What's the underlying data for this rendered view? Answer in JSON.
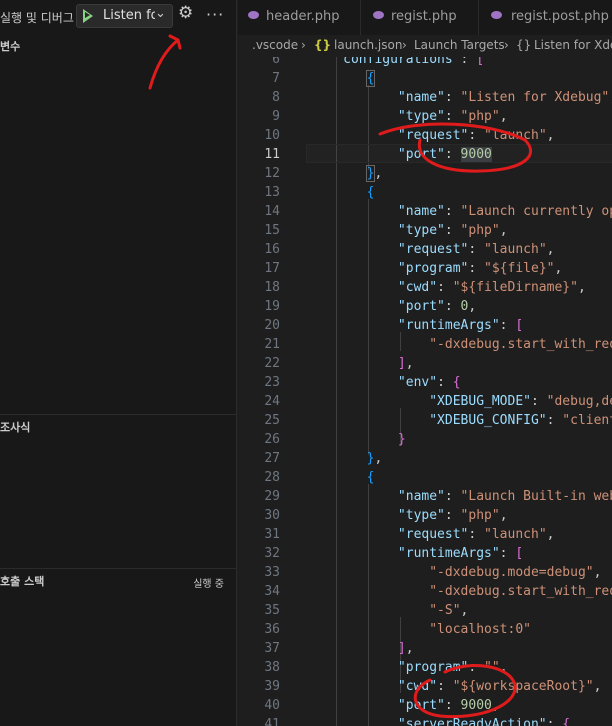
{
  "sidebar": {
    "title": "실행 및 디버그",
    "launch_config": "Listen for Xdebug",
    "sections": [
      {
        "label": "변수"
      },
      {
        "label": "조사식"
      },
      {
        "label": "호출 스택",
        "status": "실행 중"
      }
    ]
  },
  "tabs": [
    {
      "label": "header.php"
    },
    {
      "label": "regist.php"
    },
    {
      "label": "regist.post.php"
    }
  ],
  "breadcrumb": {
    "folder": ".vscode",
    "file_icon": "{}",
    "file": "launch.json",
    "node1": "Launch Targets",
    "node2_icon": "{}",
    "node2": "Listen for Xdebug"
  },
  "editor": {
    "current_line": 11,
    "lines": [
      {
        "n": "6"
      },
      {
        "n": "7"
      },
      {
        "n": "8"
      },
      {
        "n": "9"
      },
      {
        "n": "10"
      },
      {
        "n": "11"
      },
      {
        "n": "12"
      },
      {
        "n": "13"
      },
      {
        "n": "14"
      },
      {
        "n": "15"
      },
      {
        "n": "16"
      },
      {
        "n": "17"
      },
      {
        "n": "18"
      },
      {
        "n": "19"
      },
      {
        "n": "20"
      },
      {
        "n": "21"
      },
      {
        "n": "22"
      },
      {
        "n": "23"
      },
      {
        "n": "24"
      },
      {
        "n": "25"
      },
      {
        "n": "26"
      },
      {
        "n": "27"
      },
      {
        "n": "28"
      },
      {
        "n": "29"
      },
      {
        "n": "30"
      },
      {
        "n": "31"
      },
      {
        "n": "32"
      },
      {
        "n": "33"
      },
      {
        "n": "34"
      },
      {
        "n": "35"
      },
      {
        "n": "36"
      },
      {
        "n": "37"
      },
      {
        "n": "38"
      },
      {
        "n": "39"
      },
      {
        "n": "40"
      },
      {
        "n": "41"
      }
    ]
  },
  "colors": {
    "accent_play": "#89d185",
    "annotation": "#e01b1b",
    "json_key": "#9cdcfe",
    "json_string": "#ce9178",
    "json_number": "#b5cea8"
  }
}
